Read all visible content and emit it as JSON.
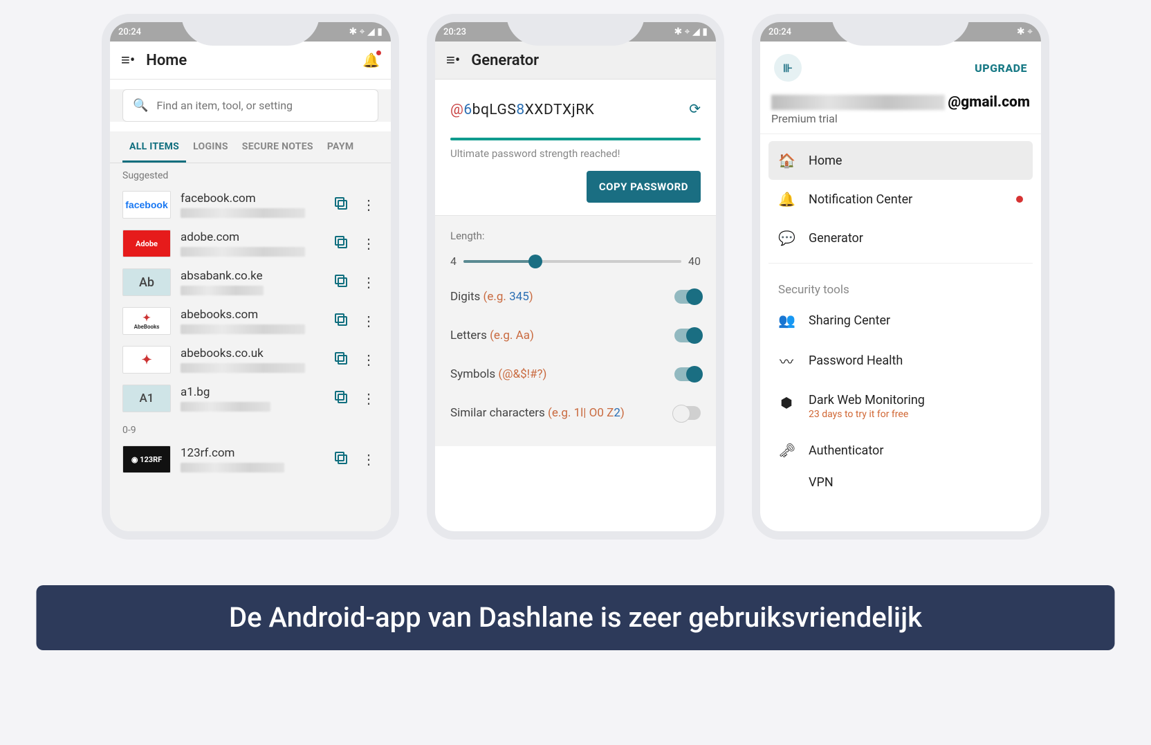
{
  "banner_text": "De Android-app van Dashlane is zeer gebruiksvriendelijk",
  "statusbar": {
    "time1": "20:24",
    "time2": "20:23",
    "time3": "20:24"
  },
  "screen1": {
    "title": "Home",
    "search_placeholder": "Find an item, tool, or setting",
    "tabs": [
      "ALL ITEMS",
      "LOGINS",
      "SECURE NOTES",
      "PAYM"
    ],
    "section_suggested": "Suggested",
    "section_09": "0-9",
    "items": [
      {
        "domain": "facebook.com",
        "logo_text": "facebook",
        "logo_class": "fb"
      },
      {
        "domain": "adobe.com",
        "logo_text": "Adobe",
        "logo_class": "adobe"
      },
      {
        "domain": "absabank.co.ke",
        "logo_text": "Ab",
        "logo_class": "ab"
      },
      {
        "domain": "abebooks.com",
        "logo_text": "AbeBooks",
        "logo_class": ""
      },
      {
        "domain": "abebooks.co.uk",
        "logo_text": "✦",
        "logo_class": ""
      },
      {
        "domain": "a1.bg",
        "logo_text": "A1",
        "logo_class": "a1"
      }
    ],
    "items09": [
      {
        "domain": "123rf.com",
        "logo_text": "◉ 123RF",
        "logo_class": "rf"
      }
    ]
  },
  "screen2": {
    "title": "Generator",
    "password": {
      "pre_sym": "@",
      "d1": "6",
      "mid1": "bqLGS",
      "d2": "8",
      "mid2": "XXDTXjRK"
    },
    "strength_text": "Ultimate password strength reached!",
    "copy_button": "COPY PASSWORD",
    "length_label": "Length:",
    "length_min": "4",
    "length_max": "40",
    "opts": {
      "digits": {
        "label": "Digits ",
        "hint": "(e.g. ",
        "ex": "345",
        "close": ")",
        "on": true
      },
      "letters": {
        "label": "Letters ",
        "hint": "(e.g. Aa)",
        "on": true
      },
      "symbols": {
        "label": "Symbols ",
        "hint": "(@&$!#?)",
        "on": true
      },
      "similar": {
        "label": "Similar characters ",
        "hint": "(e.g. 1l| O0 Z",
        "ex": "2",
        "close": ")",
        "on": false
      }
    }
  },
  "screen3": {
    "upgrade": "UPGRADE",
    "email_suffix": "@gmail.com",
    "plan": "Premium trial",
    "nav": [
      {
        "label": "Home",
        "active": true
      },
      {
        "label": "Notification Center",
        "dot": true
      },
      {
        "label": "Generator"
      }
    ],
    "security_hdr": "Security tools",
    "tools": [
      {
        "label": "Sharing Center"
      },
      {
        "label": "Password Health"
      },
      {
        "label": "Dark Web Monitoring",
        "sub": "23 days to try it for free"
      },
      {
        "label": "Authenticator"
      },
      {
        "label": "VPN"
      }
    ]
  }
}
